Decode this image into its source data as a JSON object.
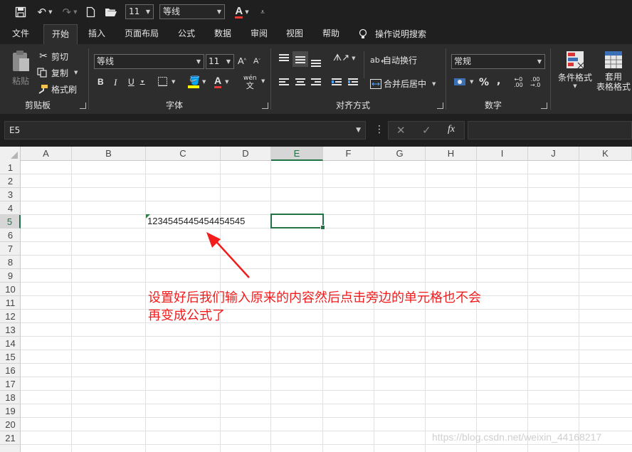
{
  "qat": {
    "font_size": "11",
    "font_name": "等线"
  },
  "tabs": [
    {
      "label": "文件"
    },
    {
      "label": "开始"
    },
    {
      "label": "插入"
    },
    {
      "label": "页面布局"
    },
    {
      "label": "公式"
    },
    {
      "label": "数据"
    },
    {
      "label": "审阅"
    },
    {
      "label": "视图"
    },
    {
      "label": "帮助"
    },
    {
      "label": "操作说明搜索"
    }
  ],
  "ribbon": {
    "clipboard": {
      "paste": "粘贴",
      "cut": "剪切",
      "copy": "复制",
      "format_painter": "格式刷",
      "group_label": "剪贴板"
    },
    "font": {
      "font_name": "等线",
      "font_size": "11",
      "bold": "B",
      "italic": "I",
      "underline": "U",
      "phonetic": "wén",
      "group_label": "字体"
    },
    "alignment": {
      "wrap_text": "自动换行",
      "merge_center": "合并后居中",
      "group_label": "对齐方式"
    },
    "number": {
      "format": "常规",
      "percent": "%",
      "comma": ",",
      "group_label": "数字"
    },
    "styles": {
      "conditional_format": "条件格式",
      "table_format_1": "套用",
      "table_format_2": "表格格式"
    }
  },
  "formula_bar": {
    "name_box": "E5",
    "cancel": "✕",
    "enter": "✓",
    "fx": "fx"
  },
  "grid": {
    "columns": [
      "A",
      "B",
      "C",
      "D",
      "E",
      "F",
      "G",
      "H",
      "I",
      "J",
      "K"
    ],
    "selected_column": "E",
    "rows": [
      "1",
      "2",
      "3",
      "4",
      "5",
      "6",
      "7",
      "8",
      "9",
      "10",
      "11",
      "12",
      "13",
      "14",
      "15",
      "16",
      "17",
      "18",
      "19",
      "20",
      "21"
    ],
    "selected_row": "5",
    "cell_c5": "1234545445454454545"
  },
  "annotation": {
    "line1": "设置好后我们输入原来的内容然后点击旁边的单元格也不会",
    "line2": "再变成公式了",
    "color": "#f21c1c"
  },
  "watermark": "https://blog.csdn.net/weixin_44168217"
}
